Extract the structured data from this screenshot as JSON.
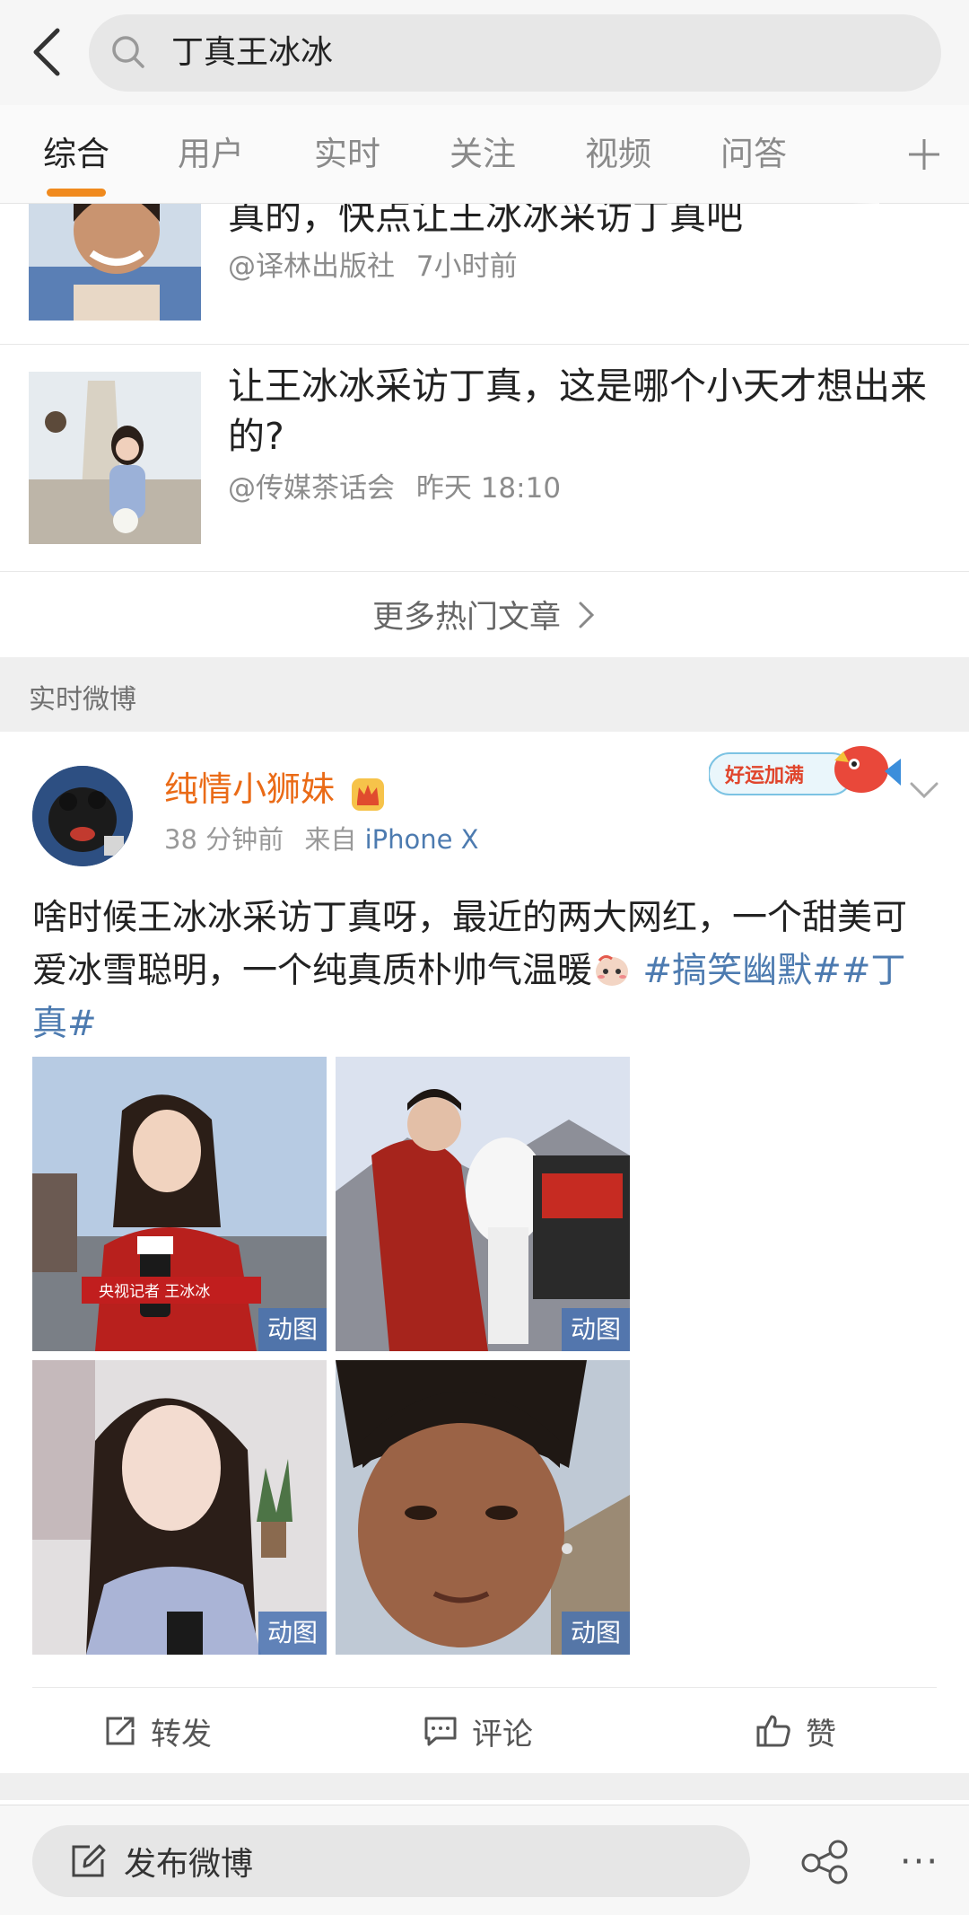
{
  "search": {
    "query": "丁真王冰冰"
  },
  "tabs": [
    {
      "label": "综合",
      "active": true
    },
    {
      "label": "用户",
      "active": false
    },
    {
      "label": "实时",
      "active": false
    },
    {
      "label": "关注",
      "active": false
    },
    {
      "label": "视频",
      "active": false
    },
    {
      "label": "问答",
      "active": false
    }
  ],
  "tabs_more_icon": "plus-icon",
  "articles": [
    {
      "title": "真的，快点让王冰冰采访丁真吧",
      "source": "@译林出版社",
      "time": "7小时前"
    },
    {
      "title": "让王冰冰采访丁真，这是哪个小天才想出来的?",
      "source": "@传媒茶话会",
      "time": "昨天 18:10"
    }
  ],
  "more_articles_label": "更多热门文章",
  "section_title": "实时微博",
  "post": {
    "author": "纯情小狮妹",
    "time_ago": "38 分钟前",
    "from_label": "来自",
    "device": "iPhone X",
    "badge_text": "好运加满",
    "text_main": "啥时候王冰冰采访丁真呀，最近的两大网红，一个甜美可爱冰雪聪明，一个纯真质朴帅气温暖",
    "tags": "#搞笑幽默##丁真#",
    "images": [
      {
        "caption": "央视记者 王冰冰",
        "badge": "动图"
      },
      {
        "badge": "动图"
      },
      {
        "badge": "动图"
      },
      {
        "badge": "动图"
      }
    ],
    "actions": {
      "repost": "转发",
      "comment": "评论",
      "like": "赞"
    }
  },
  "bottom": {
    "compose_label": "发布微博",
    "more_label": "···"
  },
  "colors": {
    "accent": "#f08a1e",
    "author": "#ea6b17",
    "link": "#4d7bb0",
    "gif_badge": "#4972b0"
  }
}
